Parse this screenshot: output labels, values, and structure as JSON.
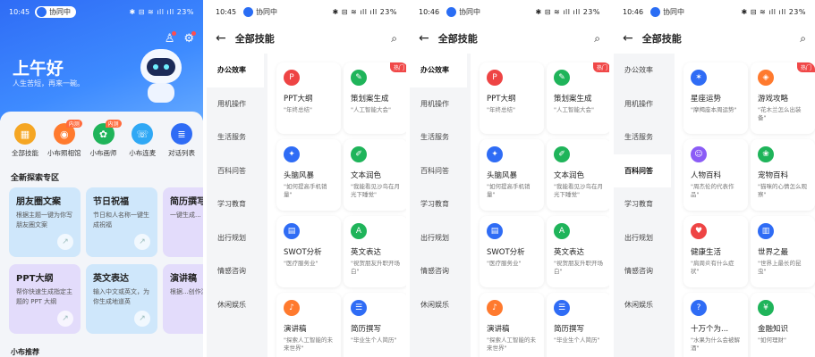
{
  "colors": {
    "primary": "#2f6cf5",
    "hot": "#f04848",
    "orange": "#ff7a2e",
    "green": "#1fb45a",
    "red": "#ee4444",
    "purple": "#8b5cf6"
  },
  "screens": [
    {
      "status": {
        "time": "10:45",
        "pill": "协同中",
        "right": "✱ ⊟ ≋ ıll ıll 23%"
      },
      "greeting": "上午好",
      "subtitle": "人生苦短，再来一碗。",
      "header_icons": [
        "user-icon",
        "settings-icon"
      ],
      "quick": [
        {
          "label": "全部技能",
          "icon": "grid-icon",
          "glyph": "▦",
          "color": "#f5a623",
          "tag": ""
        },
        {
          "label": "小布照相馆",
          "icon": "camera-icon",
          "glyph": "◉",
          "color": "#ff7a2e",
          "tag": "内测"
        },
        {
          "label": "小布画师",
          "icon": "palette-icon",
          "glyph": "✿",
          "color": "#1fb45a",
          "tag": "内测"
        },
        {
          "label": "小布连麦",
          "icon": "phone-icon",
          "glyph": "☏",
          "color": "#2fa8f5",
          "tag": ""
        },
        {
          "label": "对话列表",
          "icon": "chat-icon",
          "glyph": "≣",
          "color": "#2f6cf5",
          "tag": ""
        }
      ],
      "section_title": "全新探索专区",
      "cards": [
        {
          "title": "朋友圈文案",
          "desc": "根据主题一键为你写朋友圈文案",
          "bg": "#cfe7fb"
        },
        {
          "title": "节日祝福",
          "desc": "节日和人名称一键生成祝福",
          "bg": "#cfe7fb"
        },
        {
          "title": "简历撰写",
          "desc": "一键生成...",
          "bg": "#e3dcfb"
        },
        {
          "title": "PPT大纲",
          "desc": "帮你快速生成指定主题的 PPT 大纲",
          "bg": "#e3dcfb"
        },
        {
          "title": "英文表达",
          "desc": "输入中文或英文，为你生成地道英",
          "bg": "#cfe7fb"
        },
        {
          "title": "演讲稿",
          "desc": "根据...创作演...",
          "bg": "#e3dcfb"
        }
      ],
      "bottom_tip": "小布推荐"
    }
  ],
  "skills_screens": [
    {
      "status": {
        "time": "10:45",
        "pill": "协同中",
        "right": "✱ ⊟ ≋ ıll ıll 23%"
      },
      "title": "全部技能",
      "active": 0
    },
    {
      "status": {
        "time": "10:46",
        "pill": "协同中",
        "right": "✱ ⊟ ≋ ıll ıll 23%"
      },
      "title": "全部技能",
      "active": 0
    },
    {
      "status": {
        "time": "10:46",
        "pill": "协同中",
        "right": "✱ ⊟ ≋ ıll ıll 23%"
      },
      "title": "全部技能",
      "active": 3
    }
  ],
  "categories": [
    "办公效率",
    "用机操作",
    "生活服务",
    "百科问答",
    "学习教育",
    "出行规划",
    "情感咨询",
    "休闲娱乐"
  ],
  "hot_label": "热门",
  "skills_a": [
    {
      "name": "PPT大纲",
      "desc": "\"年终总结\"",
      "icon": "ppt-icon",
      "glyph": "P",
      "color": "#ee4444",
      "hot": false
    },
    {
      "name": "策划案生成",
      "desc": "\"人工智能大会\"",
      "icon": "plan-icon",
      "glyph": "✎",
      "color": "#1fb45a",
      "hot": true
    },
    {
      "name": "头脑风暴",
      "desc": "\"如何提高手机销量\"",
      "icon": "bulb-icon",
      "glyph": "✦",
      "color": "#2f6cf5",
      "hot": false
    },
    {
      "name": "文本润色",
      "desc": "\"我能看见沙鸟在月光下睡觉\"",
      "icon": "brush-icon",
      "glyph": "✐",
      "color": "#1fb45a",
      "hot": false
    },
    {
      "name": "SWOT分析",
      "desc": "\"医疗服务业\"",
      "icon": "chart-icon",
      "glyph": "▤",
      "color": "#2f6cf5",
      "hot": false
    },
    {
      "name": "英文表达",
      "desc": "\"祝贺朋友升职开场白\"",
      "icon": "translate-icon",
      "glyph": "A",
      "color": "#1fb45a",
      "hot": false
    },
    {
      "name": "演讲稿",
      "desc": "\"探索人工智能的未来世界\"",
      "icon": "mic-icon",
      "glyph": "♪",
      "color": "#ff7a2e",
      "hot": false
    },
    {
      "name": "简历撰写",
      "desc": "\"毕业生个人简历\"",
      "icon": "resume-icon",
      "glyph": "☰",
      "color": "#2f6cf5",
      "hot": false
    }
  ],
  "skills_b": [
    {
      "name": "星座运势",
      "desc": "\"摩羯座本周运势\"",
      "icon": "star-icon",
      "glyph": "✶",
      "color": "#2f6cf5",
      "hot": false
    },
    {
      "name": "游戏攻略",
      "desc": "\"花木兰怎么出装备\"",
      "icon": "gamepad-icon",
      "glyph": "◈",
      "color": "#ff7a2e",
      "hot": true
    },
    {
      "name": "人物百科",
      "desc": "\"周杰伦的代表作品\"",
      "icon": "person-icon",
      "glyph": "☺",
      "color": "#8b5cf6",
      "hot": false
    },
    {
      "name": "宠物百科",
      "desc": "\"猫咪的心情怎么观察\"",
      "icon": "paw-icon",
      "glyph": "❀",
      "color": "#1fb45a",
      "hot": false
    },
    {
      "name": "健康生活",
      "desc": "\"肩周炎有什么症状\"",
      "icon": "heart-icon",
      "glyph": "♥",
      "color": "#ee4444",
      "hot": false
    },
    {
      "name": "世界之最",
      "desc": "\"世界上最长的昆虫\"",
      "icon": "bars-icon",
      "glyph": "▥",
      "color": "#2f6cf5",
      "hot": false
    },
    {
      "name": "十万个为...",
      "desc": "\"水果为什么会被解酒\"",
      "icon": "question-icon",
      "glyph": "?",
      "color": "#2f6cf5",
      "hot": false
    },
    {
      "name": "金融知识",
      "desc": "\"如何理财\"",
      "icon": "money-icon",
      "glyph": "¥",
      "color": "#1fb45a",
      "hot": false
    }
  ]
}
